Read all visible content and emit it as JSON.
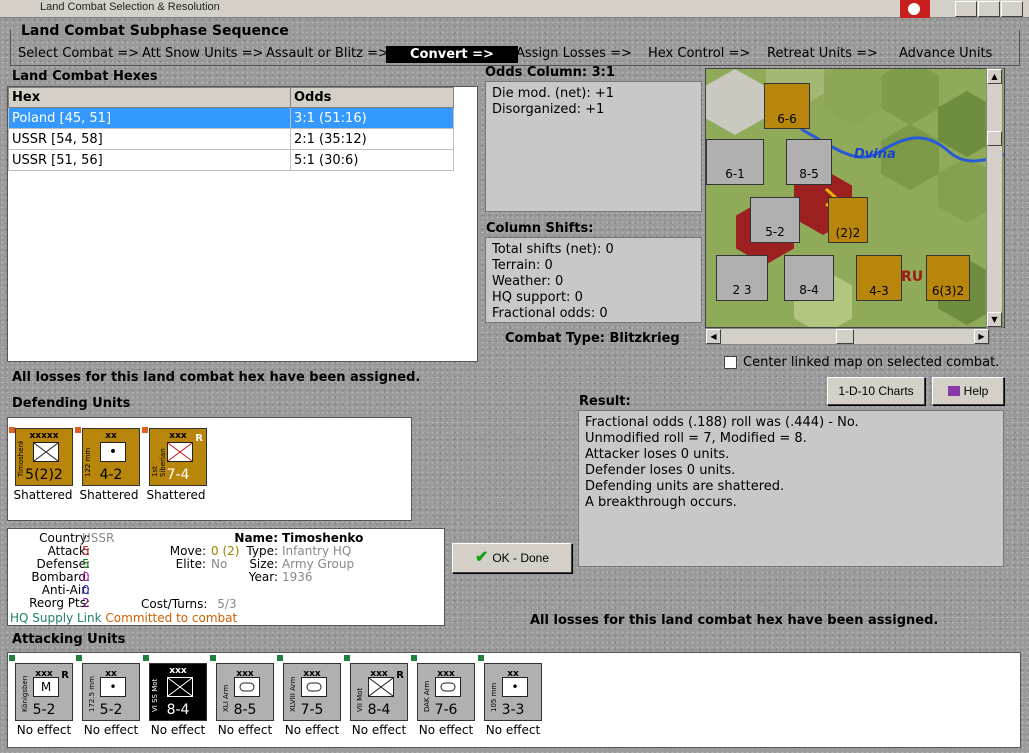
{
  "window": {
    "title": "Land Combat Selection & Resolution"
  },
  "sequence": {
    "label": "Land Combat Subphase Sequence",
    "steps": [
      "Select Combat =>",
      "Att Snow Units =>",
      "Assault or Blitz =>",
      "Convert =>",
      "Assign Losses =>",
      "Hex Control =>",
      "Retreat Units =>",
      "Advance Units"
    ],
    "active_index": 3
  },
  "hexes": {
    "label": "Land Combat Hexes",
    "headers": [
      "Hex",
      "Odds"
    ],
    "rows": [
      {
        "hex": "Poland [45, 51]",
        "odds": "3:1 (51:16)"
      },
      {
        "hex": "USSR [54, 58]",
        "odds": "2:1 (35:12)"
      },
      {
        "hex": "USSR [51, 56]",
        "odds": "5:1 (30:6)"
      }
    ]
  },
  "odds": {
    "label": "Odds Column: 3:1",
    "lines": [
      "Die mod. (net): +1",
      "Disorganized: +1"
    ]
  },
  "shifts": {
    "label": "Column Shifts:",
    "lines": [
      "Total shifts (net): 0",
      "Terrain: 0",
      "Weather: 0",
      "HQ support: 0",
      "Fractional odds: 0"
    ]
  },
  "combat_type": {
    "label": "Combat Type:",
    "value": "Blitzkrieg"
  },
  "map": {
    "river_label": "Dvina",
    "center_checkbox": "Center linked map on selected combat."
  },
  "status_top": "All losses for this land combat hex have been assigned.",
  "buttons": {
    "charts": "1-D-10 Charts",
    "help": "Help",
    "ok": "OK - Done"
  },
  "result": {
    "label": "Result:",
    "lines": [
      "Fractional odds (.188) roll was (.444)  - No.",
      "Unmodified roll = 7, Modified = 8.",
      "Attacker loses 0 units.",
      "Defender loses 0 units.",
      "Defending units are shattered.",
      "A breakthrough occurs."
    ]
  },
  "defending": {
    "label": "Defending Units",
    "units": [
      {
        "size": "xxxxx",
        "name": "Timoshenko",
        "str": "5(2)2",
        "status": "Shattered",
        "r": ""
      },
      {
        "size": "xx",
        "name": "122 mm",
        "str": "4-2",
        "status": "Shattered",
        "r": ""
      },
      {
        "size": "xxx",
        "name": "1st Siberian",
        "str": "7-4",
        "status": "Shattered",
        "r": "R"
      }
    ]
  },
  "unit_info": {
    "country_label": "Country:",
    "country": "USSR",
    "attack_label": "Attack:",
    "attack": "5",
    "defense_label": "Defense:",
    "defense": "5",
    "bombard_label": "Bombard:",
    "bombard": "0",
    "antiair_label": "Anti-Air:",
    "antiair": "0",
    "reorg_label": "Reorg Pts:",
    "reorg": "2",
    "name_label": "Name:",
    "name": "Timoshenko",
    "move_label": "Move:",
    "move": "0 (2)",
    "type_label": "Type:",
    "type": "Infantry HQ",
    "elite_label": "Elite:",
    "elite": "No",
    "unit_size_label": "Size:",
    "unit_size": "Army Group",
    "year_label": "Year:",
    "year": "1936",
    "cost_label": "Cost/Turns:",
    "cost": "5/3",
    "supply": "HQ Supply Link",
    "committed": "Committed to combat"
  },
  "status_bottom": "All losses for this land combat hex have been assigned.",
  "attacking": {
    "label": "Attacking Units",
    "units": [
      {
        "size": "xxx",
        "name": "Königsberg",
        "str": "5-2",
        "status": "No effect",
        "r": "R",
        "sym": "M"
      },
      {
        "size": "xx",
        "name": "172.5 mm",
        "str": "5-2",
        "status": "No effect",
        "r": "",
        "sym": "•"
      },
      {
        "size": "xxx",
        "name": "VI SS Mot",
        "str": "8-4",
        "status": "No effect",
        "r": "",
        "sym": "x"
      },
      {
        "size": "xxx",
        "name": "XLI Arm",
        "str": "8-5",
        "status": "No effect",
        "r": "",
        "sym": "o"
      },
      {
        "size": "xxx",
        "name": "XLVIII Arm",
        "str": "7-5",
        "status": "No effect",
        "r": "",
        "sym": "o"
      },
      {
        "size": "xxx",
        "name": "VII Mot",
        "str": "8-4",
        "status": "No effect",
        "r": "R",
        "sym": "x"
      },
      {
        "size": "xxx",
        "name": "DAK Arm",
        "str": "7-6",
        "status": "No effect",
        "r": "",
        "sym": "o"
      },
      {
        "size": "xx",
        "name": "105 mm",
        "str": "3-3",
        "status": "No effect",
        "r": "",
        "sym": "•"
      }
    ]
  }
}
